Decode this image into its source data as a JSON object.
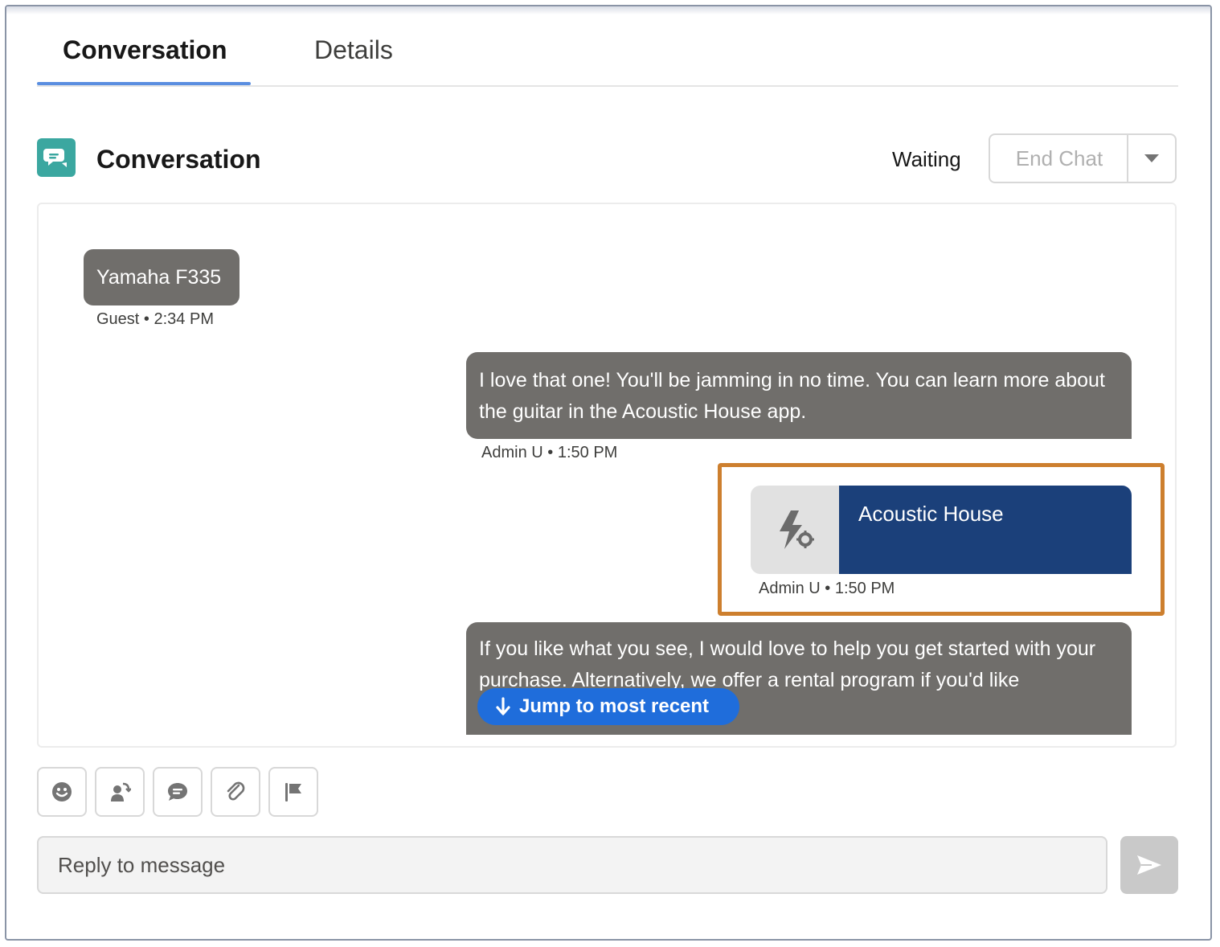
{
  "tabs": [
    {
      "label": "Conversation",
      "active": true
    },
    {
      "label": "Details",
      "active": false
    }
  ],
  "header": {
    "title": "Conversation",
    "icon": "chat-bubbles-icon",
    "status": "Waiting",
    "end_chat_label": "End Chat"
  },
  "messages": [
    {
      "text": "Yamaha F335",
      "sender": "Guest",
      "time": "2:34 PM"
    },
    {
      "text": "I love that one! You'll be jamming in no time. You can learn more about the guitar in the Acoustic House app.",
      "sender": "Admin U",
      "time": "1:50 PM"
    },
    {
      "text": "Acoustic House",
      "sender": "Admin U",
      "time": "1:50 PM",
      "icon": "lightning-gear-icon"
    },
    {
      "text": "If you like what you see, I would love to help you get started with your purchase. Alternatively, we offer a rental program if you'd like",
      "sender": "",
      "time": ""
    }
  ],
  "meta_separator": "•",
  "jump_label": "Jump to most recent",
  "toolbar": [
    "emoji-icon",
    "transfer-icon",
    "quick-text-icon",
    "attachment-icon",
    "flag-icon"
  ],
  "reply": {
    "placeholder": "Reply to message"
  },
  "colors": {
    "accent": "#5a8ee0",
    "bubble": "#706e6b",
    "app_card": "#1b407a",
    "highlight": "#cd7f2e",
    "jump_button": "#1f6ddb",
    "conversation_icon": "#3ba7a0"
  }
}
